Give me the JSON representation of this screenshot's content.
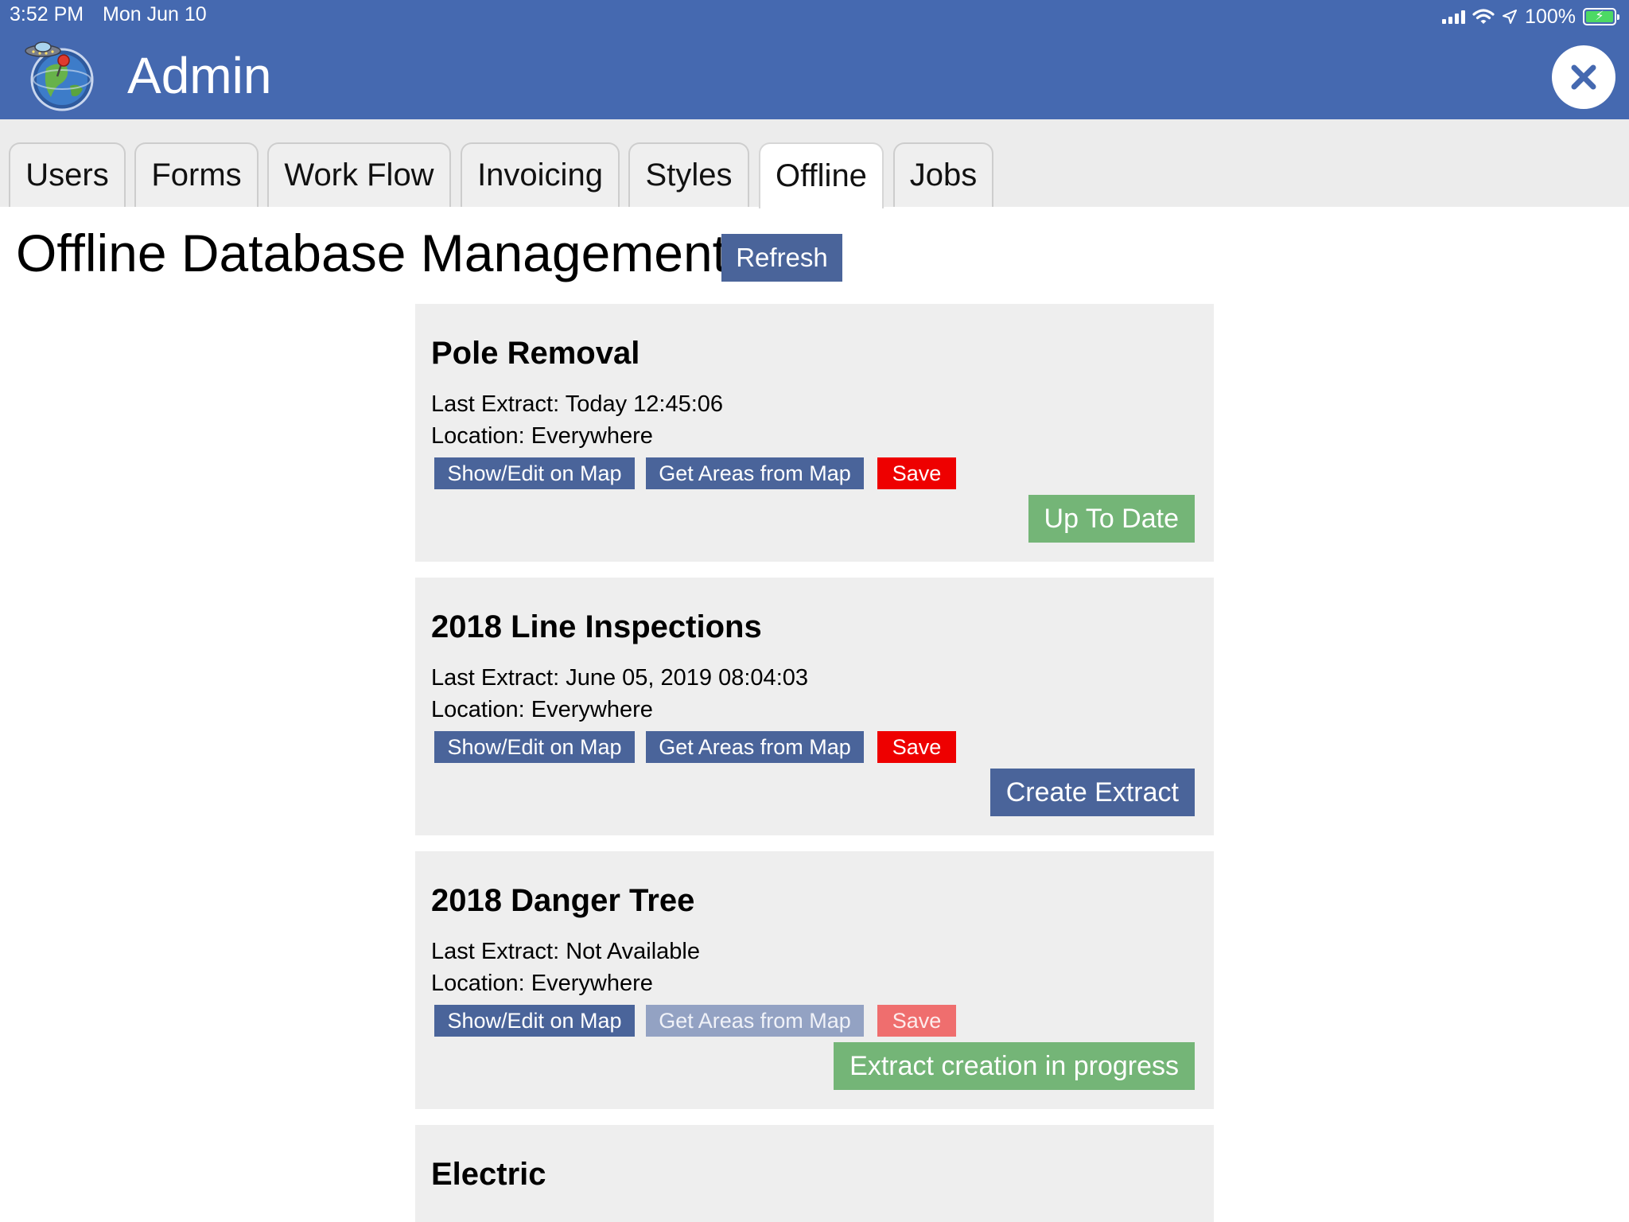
{
  "status_bar": {
    "time": "3:52 PM",
    "date": "Mon Jun 10",
    "battery": "100%",
    "icons": [
      "signal-icon",
      "wifi-icon",
      "location-arrow-icon",
      "battery-icon"
    ]
  },
  "header": {
    "title": "Admin",
    "logo_icon": "globe-ufo-logo-icon",
    "close_icon": "close-x-icon",
    "background_color": "#4569b0"
  },
  "tabs": [
    {
      "label": "Users"
    },
    {
      "label": "Forms"
    },
    {
      "label": "Work Flow"
    },
    {
      "label": "Invoicing"
    },
    {
      "label": "Styles"
    },
    {
      "label": "Offline",
      "active": true
    },
    {
      "label": "Jobs"
    }
  ],
  "page": {
    "title": "Offline Database Management",
    "refresh_label": "Refresh"
  },
  "cards": [
    {
      "name": "Pole Removal",
      "last_extract_label": "Last Extract:",
      "last_extract_value": "Today 12:45:06",
      "location_label": "Location:",
      "location_value": "Everywhere",
      "map_button": "Show/Edit on Map",
      "areas_button": "Get Areas from Map",
      "save_button": "Save",
      "status_button": "Up To Date",
      "status_color": "#74b577"
    },
    {
      "name": "2018 Line Inspections",
      "last_extract_label": "Last Extract:",
      "last_extract_value": "June 05, 2019 08:04:03",
      "location_label": "Location:",
      "location_value": "Everywhere",
      "map_button": "Show/Edit on Map",
      "areas_button": "Get Areas from Map",
      "save_button": "Save",
      "status_button": "Create Extract",
      "status_color": "#4a649a"
    },
    {
      "name": "2018 Danger Tree",
      "last_extract_label": "Last Extract:",
      "last_extract_value": "Not Available",
      "location_label": "Location:",
      "location_value": "Everywhere",
      "map_button": "Show/Edit on Map",
      "areas_button": "Get Areas from Map",
      "save_button": "Save",
      "status_button": "Extract creation in progress",
      "status_color": "#74b577",
      "areas_disabled": true,
      "save_disabled": true
    },
    {
      "name": "Electric"
    }
  ]
}
